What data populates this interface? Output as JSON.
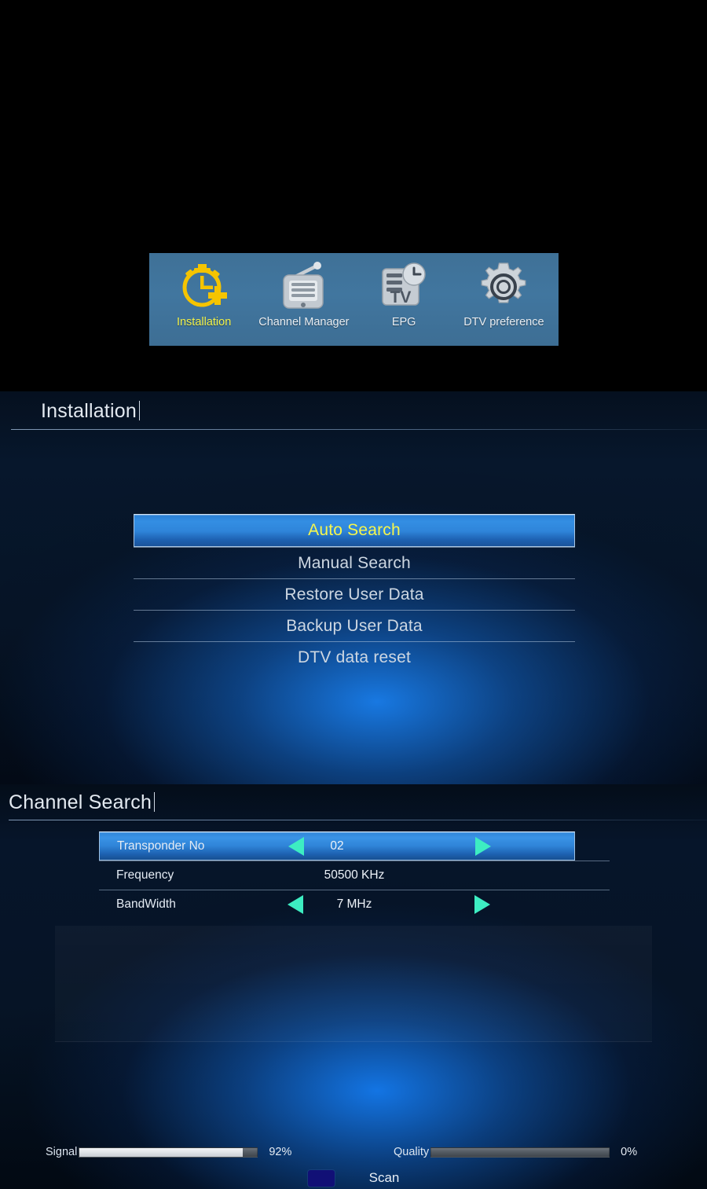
{
  "top_menu": {
    "items": [
      {
        "label": "Installation",
        "icon": "stopwatch-add-icon",
        "active": true
      },
      {
        "label": "Channel Manager",
        "icon": "radio-icon",
        "active": false
      },
      {
        "label": "EPG",
        "icon": "epg-tv-clock-icon",
        "active": false
      },
      {
        "label": "DTV preference",
        "icon": "gear-icon",
        "active": false
      }
    ],
    "bar_color": "#41769f",
    "active_label_color": "#f2f24a"
  },
  "installation": {
    "title": "Installation",
    "menu": [
      {
        "label": "Auto Search",
        "selected": true
      },
      {
        "label": "Manual Search",
        "selected": false
      },
      {
        "label": "Restore User Data",
        "selected": false
      },
      {
        "label": "Backup User Data",
        "selected": false
      },
      {
        "label": "DTV data reset",
        "selected": false
      }
    ],
    "highlight_text_color": "#f6f64c"
  },
  "channel_search": {
    "title": "Channel Search",
    "settings": [
      {
        "label": "Transponder No",
        "value": "02",
        "selected": true,
        "has_arrows": true
      },
      {
        "label": "Frequency",
        "value": "50500  KHz",
        "selected": false,
        "has_arrows": false
      },
      {
        "label": "BandWidth",
        "value": "7  MHz",
        "selected": false,
        "has_arrows": true
      }
    ],
    "arrow_color": "#3dedc2",
    "meters": {
      "signal": {
        "label": "Signal",
        "percent_text": "92%",
        "percent": 92
      },
      "quality": {
        "label": "Quality",
        "percent_text": "0%",
        "percent": 0
      }
    },
    "action": {
      "key_color": "#111076",
      "label": "Scan"
    }
  }
}
